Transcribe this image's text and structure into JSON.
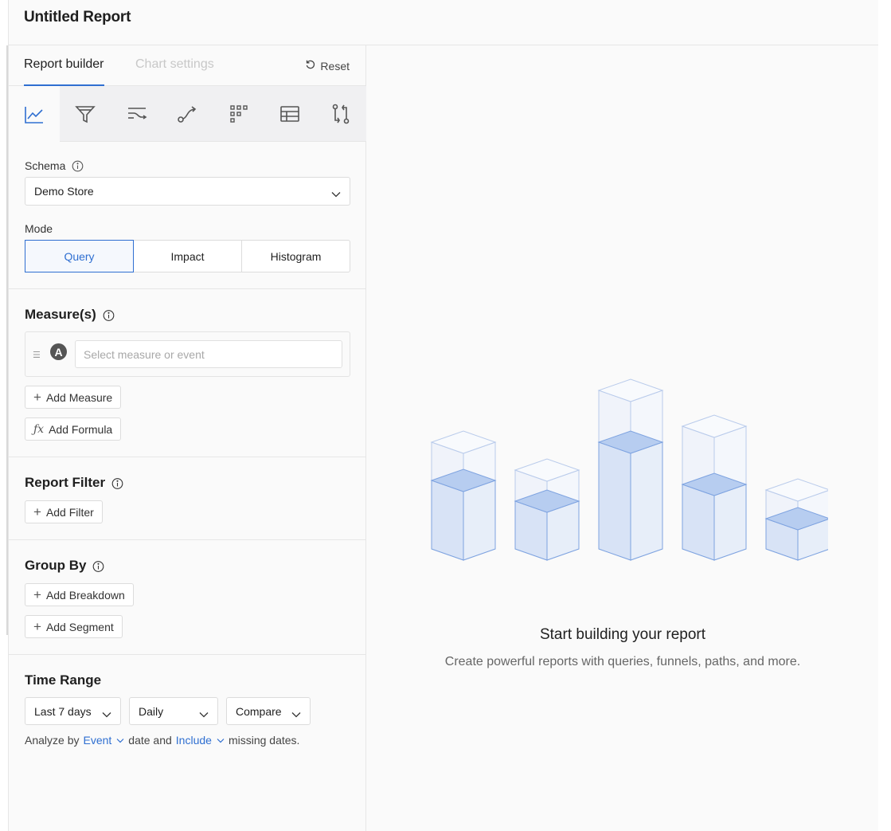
{
  "header": {
    "title": "Untitled Report"
  },
  "tabs": {
    "active": "Report builder",
    "inactive": "Chart settings",
    "reset": "Reset"
  },
  "chart_types": [
    {
      "icon": "line-chart-icon",
      "active": true
    },
    {
      "icon": "funnel-icon",
      "active": false
    },
    {
      "icon": "flows-icon",
      "active": false
    },
    {
      "icon": "path-icon",
      "active": false
    },
    {
      "icon": "grid-icon",
      "active": false
    },
    {
      "icon": "table-icon",
      "active": false
    },
    {
      "icon": "compare-icon",
      "active": false
    }
  ],
  "schema": {
    "label": "Schema",
    "value": "Demo Store"
  },
  "mode": {
    "label": "Mode",
    "options": [
      "Query",
      "Impact",
      "Histogram"
    ],
    "selected": "Query"
  },
  "measures": {
    "label": "Measure(s)",
    "badge": "A",
    "placeholder": "Select measure or event",
    "add_measure": "Add Measure",
    "add_formula": "Add Formula"
  },
  "report_filter": {
    "label": "Report Filter",
    "add_filter": "Add Filter"
  },
  "group_by": {
    "label": "Group By",
    "add_breakdown": "Add Breakdown",
    "add_segment": "Add Segment"
  },
  "time_range": {
    "label": "Time Range",
    "range": "Last 7 days",
    "granularity": "Daily",
    "compare": "Compare",
    "analyze_prefix": "Analyze by",
    "analyze_by": "Event",
    "analyze_mid": "date and",
    "missing_option": "Include",
    "analyze_suffix": "missing dates."
  },
  "empty_state": {
    "title": "Start building your report",
    "subtitle": "Create powerful reports with queries, funnels, paths, and more."
  },
  "colors": {
    "accent": "#2f6fd1",
    "illustration_fill": "#d6e2f6",
    "illustration_stroke": "#7ea3e0"
  }
}
